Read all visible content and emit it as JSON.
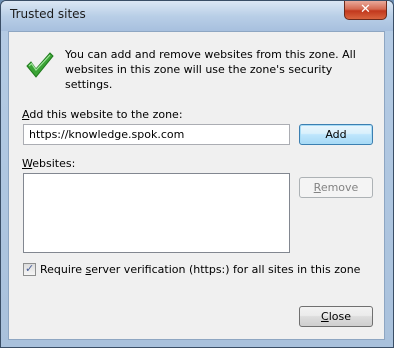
{
  "window": {
    "title": "Trusted sites",
    "close_glyph": "✕"
  },
  "info": {
    "icon": "checkmark-icon",
    "text": "You can add and remove websites from this zone. All websites in this zone will use the zone's security settings."
  },
  "add_section": {
    "label_prefix": "",
    "label_accel": "A",
    "label_rest": "dd this website to the zone:",
    "input_value": "https://knowledge.spok.com",
    "add_button": "Add"
  },
  "websites_section": {
    "label_accel": "W",
    "label_rest": "ebsites:",
    "items": [],
    "remove_button_accel": "R",
    "remove_button_rest": "emove"
  },
  "verification": {
    "checked": true,
    "label_pre": "Require ",
    "label_accel": "s",
    "label_rest": "erver verification (https:) for all sites in this zone"
  },
  "footer": {
    "close_button_accel": "C",
    "close_button_rest": "lose"
  },
  "colors": {
    "accent_check": "#3aa335",
    "title_bar": "#b9cfe7",
    "close_button": "#c1381d"
  }
}
